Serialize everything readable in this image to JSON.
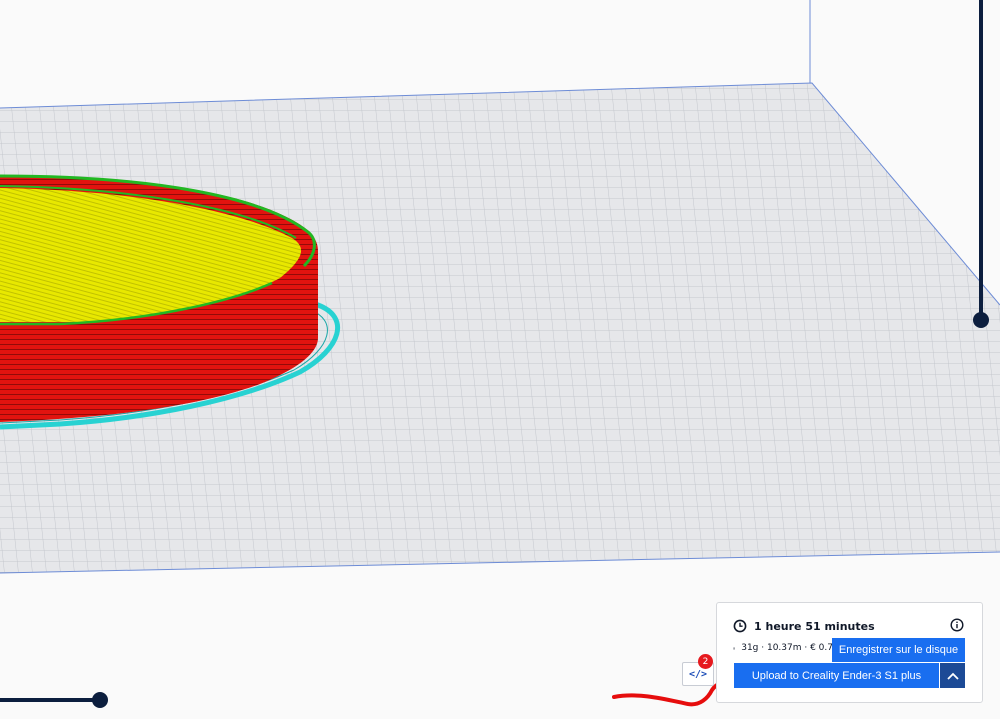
{
  "print_info": {
    "time_label": "1 heure 51 minutes",
    "material_label": "31g · 10.37m · € 0.7"
  },
  "actions": {
    "save_to_disk": "Enregistrer sur le disque",
    "upload_label": "Upload to Creality Ender-3 S1 plus"
  },
  "notifications": {
    "gcode_badge_count": "2",
    "gcode_icon": "</>"
  },
  "icons": {
    "time": "clock-icon",
    "material": "spool-icon",
    "info": "info-icon",
    "expand": "chevron-up-icon"
  },
  "colors": {
    "accent": "#196ef0",
    "accent_dark": "#1c4a96",
    "slider": "#0c1e3e",
    "model_walls": "#e2130f",
    "model_infill": "#e6e600",
    "model_outline": "#22b822",
    "skirt": "#28d2d2",
    "annotation": "#e60d0d"
  }
}
